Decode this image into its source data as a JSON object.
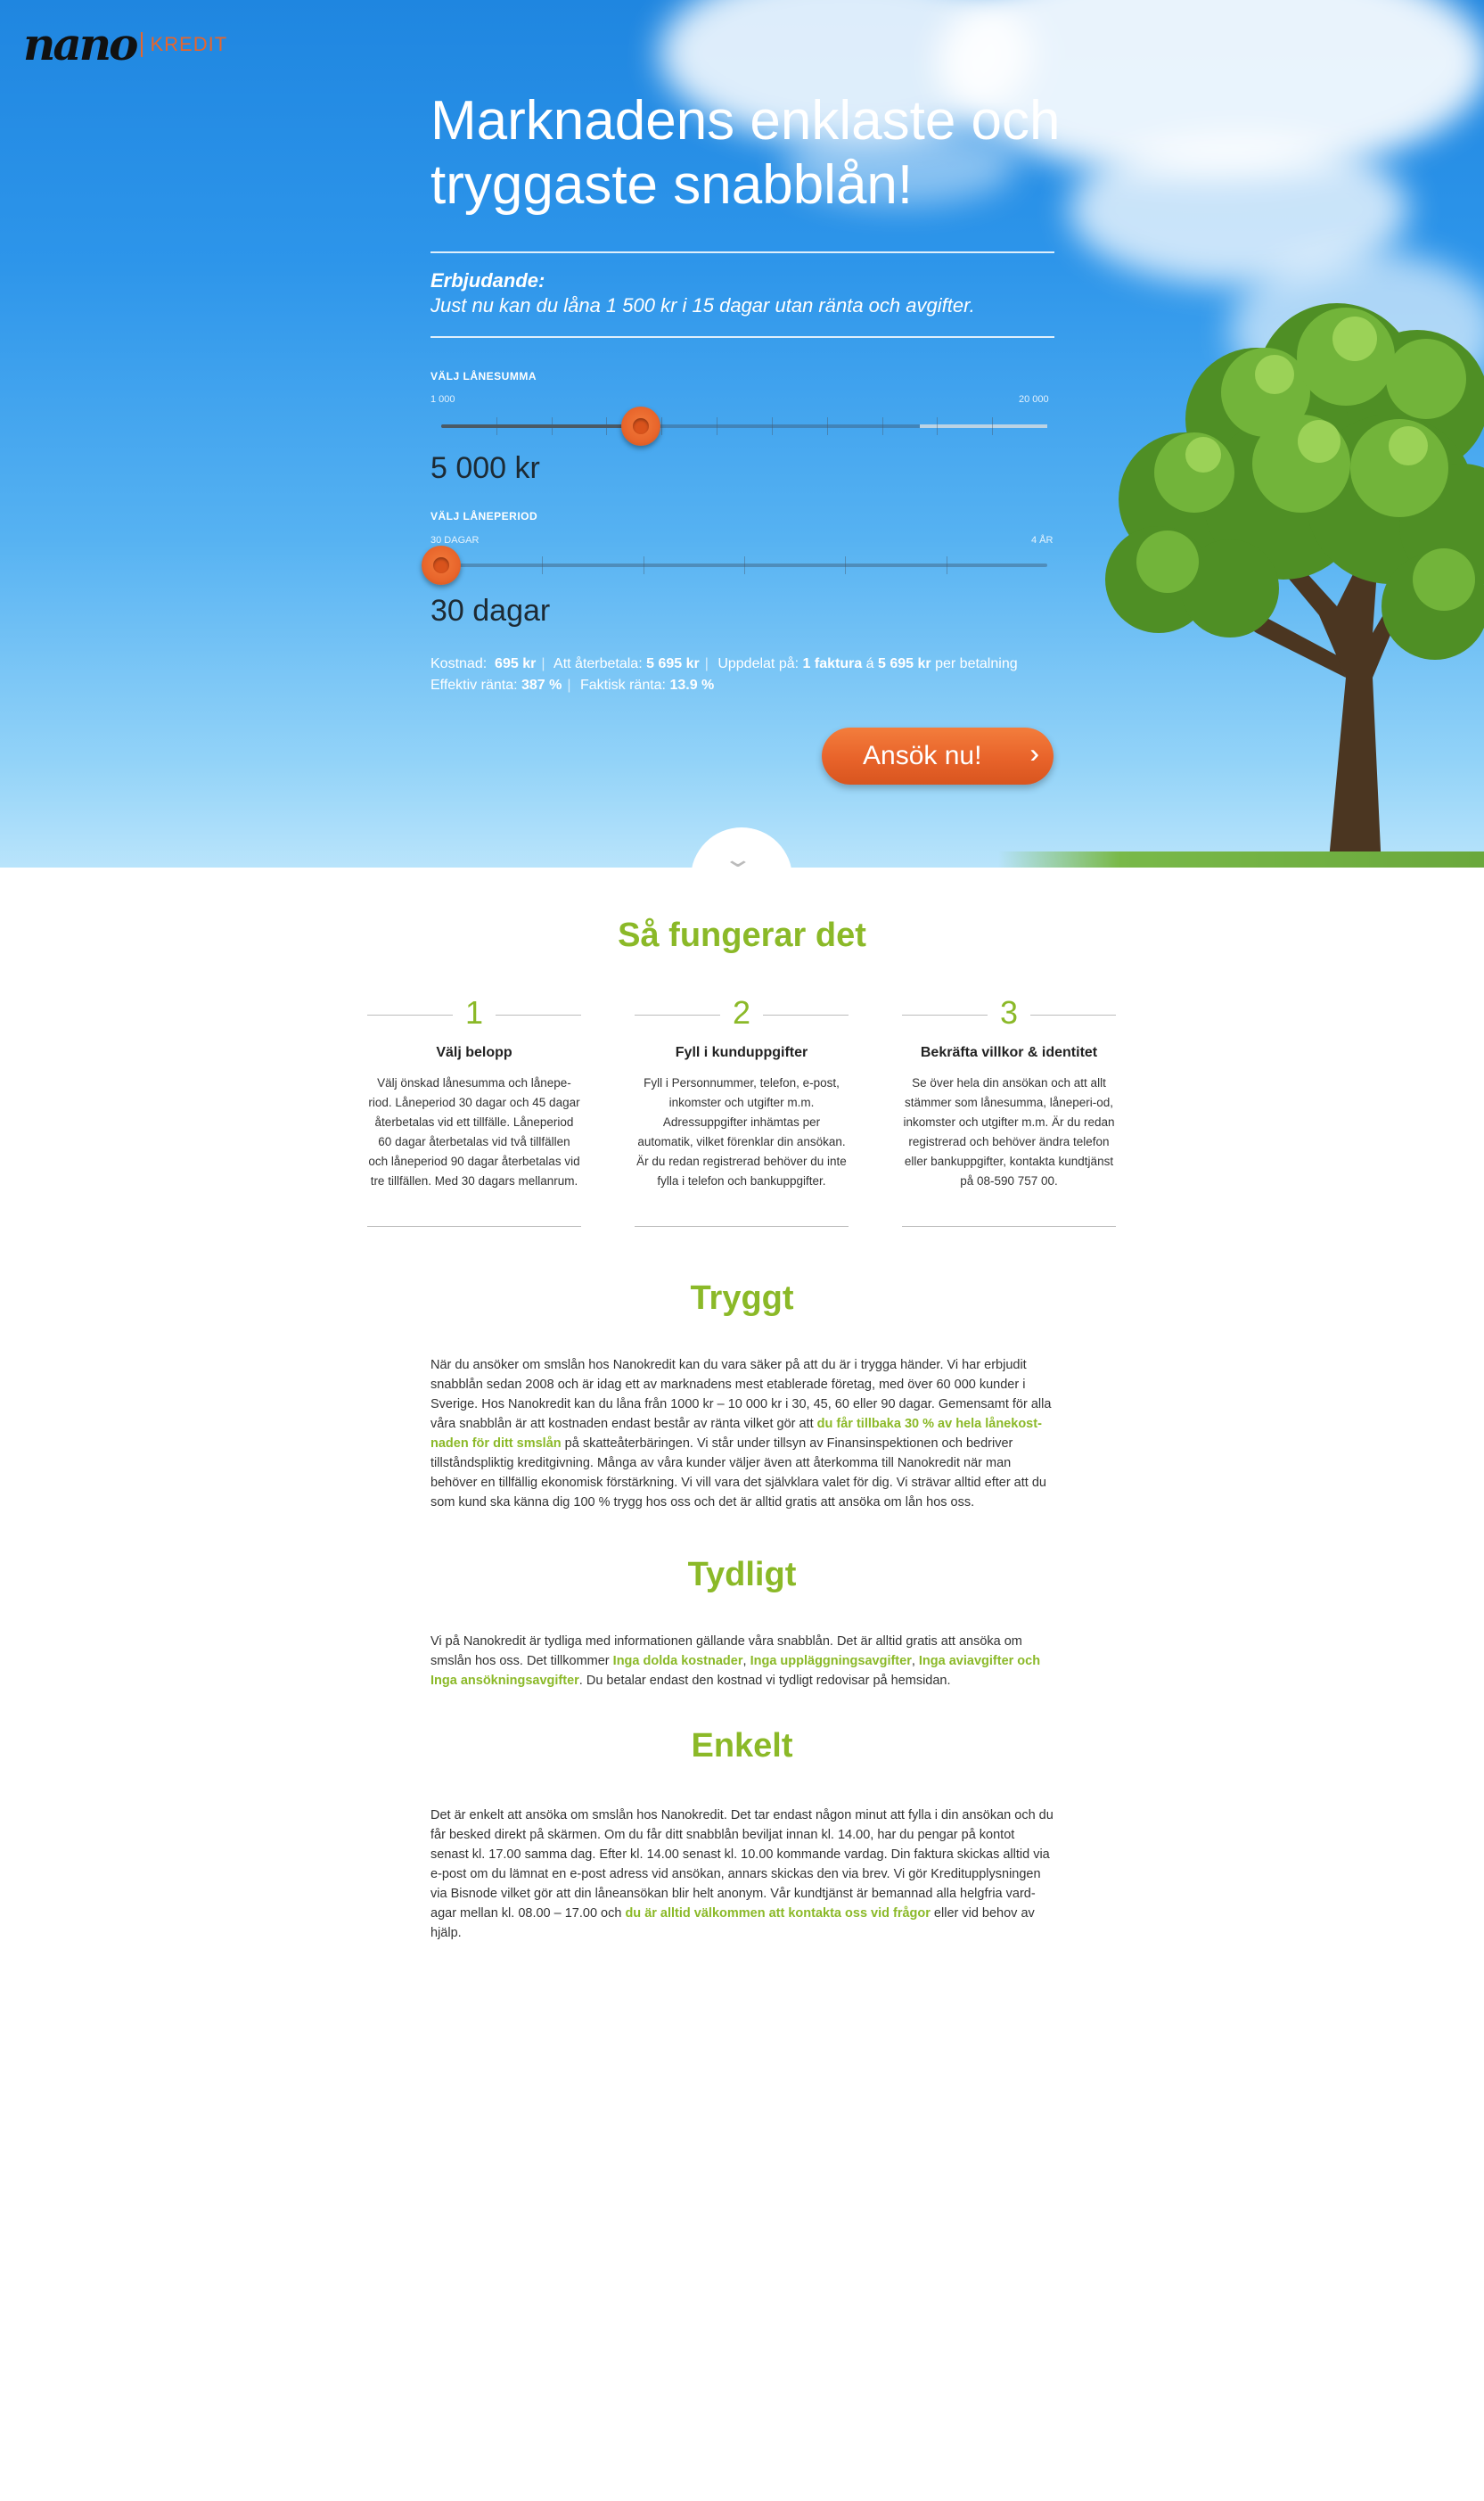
{
  "header": {
    "logo_main": "nano",
    "logo_sub": "KREDIT"
  },
  "hero": {
    "title": "Marknadens enklaste och tryggaste snabblån!",
    "offer_title": "Erbjudande:",
    "offer_text": "Just nu kan du låna 1 500 kr i 15 dagar utan ränta och avgifter."
  },
  "amount_slider": {
    "label": "VÄLJ LÅNESUMMA",
    "min": "1 000",
    "max": "20 000",
    "value": "5 000 kr",
    "level_fraction": 0.33,
    "extra_segment_fraction": 0.21
  },
  "period_slider": {
    "label": "VÄLJ LÅNEPERIOD",
    "min": "30 DAGAR",
    "max": "4 ÅR",
    "value": "30 dagar",
    "level_fraction": 0.0
  },
  "costs": {
    "kostnad_label": "Kostnad:",
    "kostnad_value": "695 kr",
    "aterbetala_label": "Att återbetala:",
    "aterbetala_value": "5 695 kr",
    "uppdelat_label": "Uppdelat på:",
    "uppdelat_value": "1 faktura",
    "a_word": "á",
    "per_value": "5 695 kr",
    "per_suffix": "per betalning",
    "effektiv_label": "Effektiv ränta:",
    "effektiv_value": "387 %",
    "faktisk_label": "Faktisk ränta:",
    "faktisk_value": "13.9 %"
  },
  "apply_button": {
    "label": "Ansök nu!",
    "chevrons": "»"
  },
  "how_it_works": {
    "title": "Så fungerar det",
    "steps": [
      {
        "number": "1",
        "title": "Välj belopp",
        "text": "Välj önskad lånesumma och lånepe-riod. Låneperiod 30 dagar och 45 dagar återbetalas vid ett tillfälle. Låneperiod 60 dagar återbetalas vid två tillfällen och låneperiod 90 dagar återbetalas vid tre tillfällen. Med 30 dagars mellanrum."
      },
      {
        "number": "2",
        "title": "Fyll i kunduppgifter",
        "text": "Fyll i Personnummer, telefon, e-post, inkomster och utgifter m.m. Adressuppgifter inhämtas per automatik, vilket förenklar din ansökan. Är du redan registrerad behöver du inte fylla i telefon och bankuppgifter."
      },
      {
        "number": "3",
        "title": "Bekräfta villkor & identitet",
        "text": "Se över hela din ansökan och att allt stämmer som lånesumma, låneperi-od, inkomster och utgifter m.m. Är du redan registrerad och behöver ändra telefon eller bankuppgifter, kontakta kundtjänst på 08-590 757 00."
      }
    ]
  },
  "tryggt": {
    "title": "Tryggt",
    "text_1": "När du ansöker om smslån hos Nanokredit kan du vara säker på att du är i trygga händer. Vi har erbjudit snabblån sedan 2008 och är idag ett av marknadens mest etablerade företag, med över 60 000 kunder i Sverige. Hos Nanokredit kan du låna från 1000 kr – 10 000 kr i 30, 45, 60 eller 90 dagar. Gemensamt för alla våra snabblån är att kostnaden endast består av ränta vilket gör att ",
    "highlight": "du får tillbaka 30 % av hela lånekost-naden för ditt smslån",
    "text_2": " på skatteåterbäringen. Vi står under tillsyn av Finansinspektionen och bedriver tillståndspliktig kreditgivning. Många av våra kunder väljer även att återkomma till Nanokredit när man behöver en tillfällig ekonomisk förstärkning. Vi vill vara det självklara valet för dig. Vi strävar alltid efter att du som kund ska känna dig 100 % trygg hos oss och det är alltid gratis att ansöka om lån hos oss."
  },
  "tydligt": {
    "title": "Tydligt",
    "text_1": "Vi på Nanokredit är tydliga med informationen gällande våra snabblån. Det är alltid gratis att ansöka om smslån hos oss. Det tillkommer ",
    "hl_1": "Inga dolda kostnader",
    "comma_1": ", ",
    "hl_2": "Inga uppläggningsavgifter",
    "comma_2": ", ",
    "hl_3": "Inga aviavgifter och Inga ansökningsavgifter",
    "text_2": ". Du betalar endast den kostnad vi tydligt redovisar på hemsidan."
  },
  "enkelt": {
    "title": "Enkelt",
    "text_1": "Det är enkelt att ansöka om smslån hos Nanokredit. Det tar endast någon minut att fylla i din ansökan och du får besked direkt på skärmen. Om du får ditt snabblån beviljat innan kl. 14.00, har du pengar på kontot senast kl. 17.00 samma dag. Efter kl. 14.00 senast kl. 10.00 kommande vardag. Din faktura skickas alltid via e-post om du lämnat en e-post adress vid ansökan, annars skickas den via brev. Vi gör Kreditupplysningen via Bisnode vilket gör att din låneansökan blir helt anonym. Vår kundtjänst är bemannad alla helgfria vard-agar mellan kl. 08.00 – 17.00 och ",
    "highlight": "du är alltid välkommen att kontakta oss vid frågor",
    "text_2": " eller vid behov av hjälp."
  },
  "colors": {
    "accent_green": "#8bb928",
    "accent_orange": "#e8652b",
    "sky_blue": "#2d95ea"
  },
  "icons": {
    "down": "chevron-down-icon",
    "apply": "double-chevron-right-icon"
  }
}
